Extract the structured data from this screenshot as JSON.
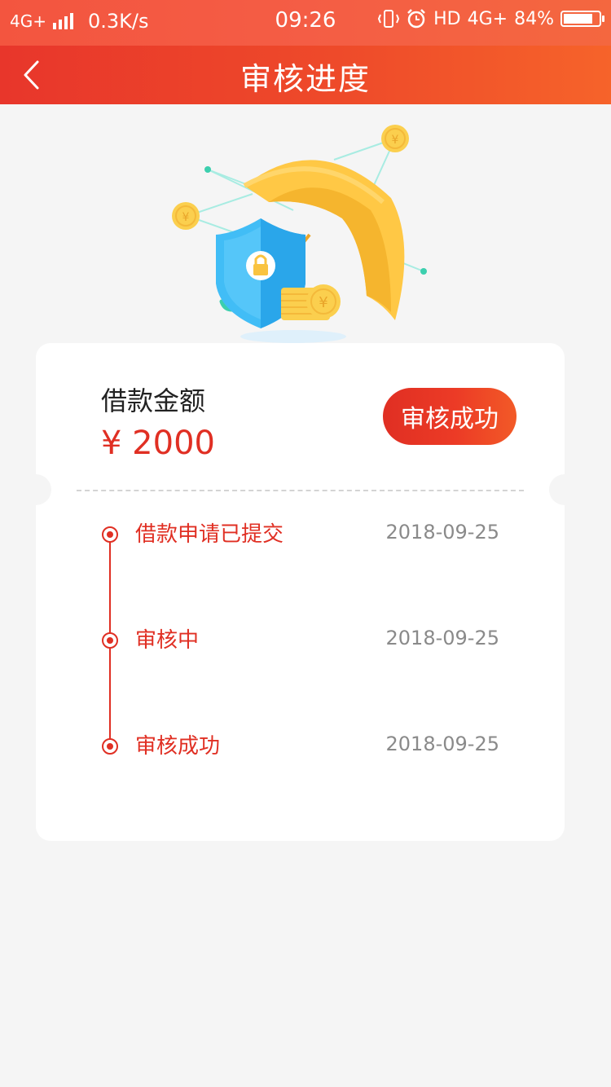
{
  "status_bar": {
    "network": "4G+",
    "speed": "0.3K/s",
    "time": "09:26",
    "hd": "HD",
    "network2": "4G+",
    "battery": "84%",
    "battery_level": 0.84
  },
  "nav": {
    "title": "审核进度"
  },
  "card": {
    "amount_label": "借款金额",
    "amount_value": "¥ 2000",
    "status_button": "审核成功",
    "steps": [
      {
        "label": "借款申请已提交",
        "date": "2018-09-25"
      },
      {
        "label": "审核中",
        "date": "2018-09-25"
      },
      {
        "label": "审核成功",
        "date": "2018-09-25"
      }
    ]
  },
  "colors": {
    "accent": "#e02f23",
    "header_start": "#e8362b",
    "header_end": "#f6632a",
    "background": "#f5f5f5"
  },
  "icons": [
    "back-arrow-icon",
    "signal-icon",
    "vibrate-icon",
    "alarm-icon",
    "battery-icon",
    "shield-lock-icon",
    "umbrella-icon",
    "coin-icon"
  ]
}
